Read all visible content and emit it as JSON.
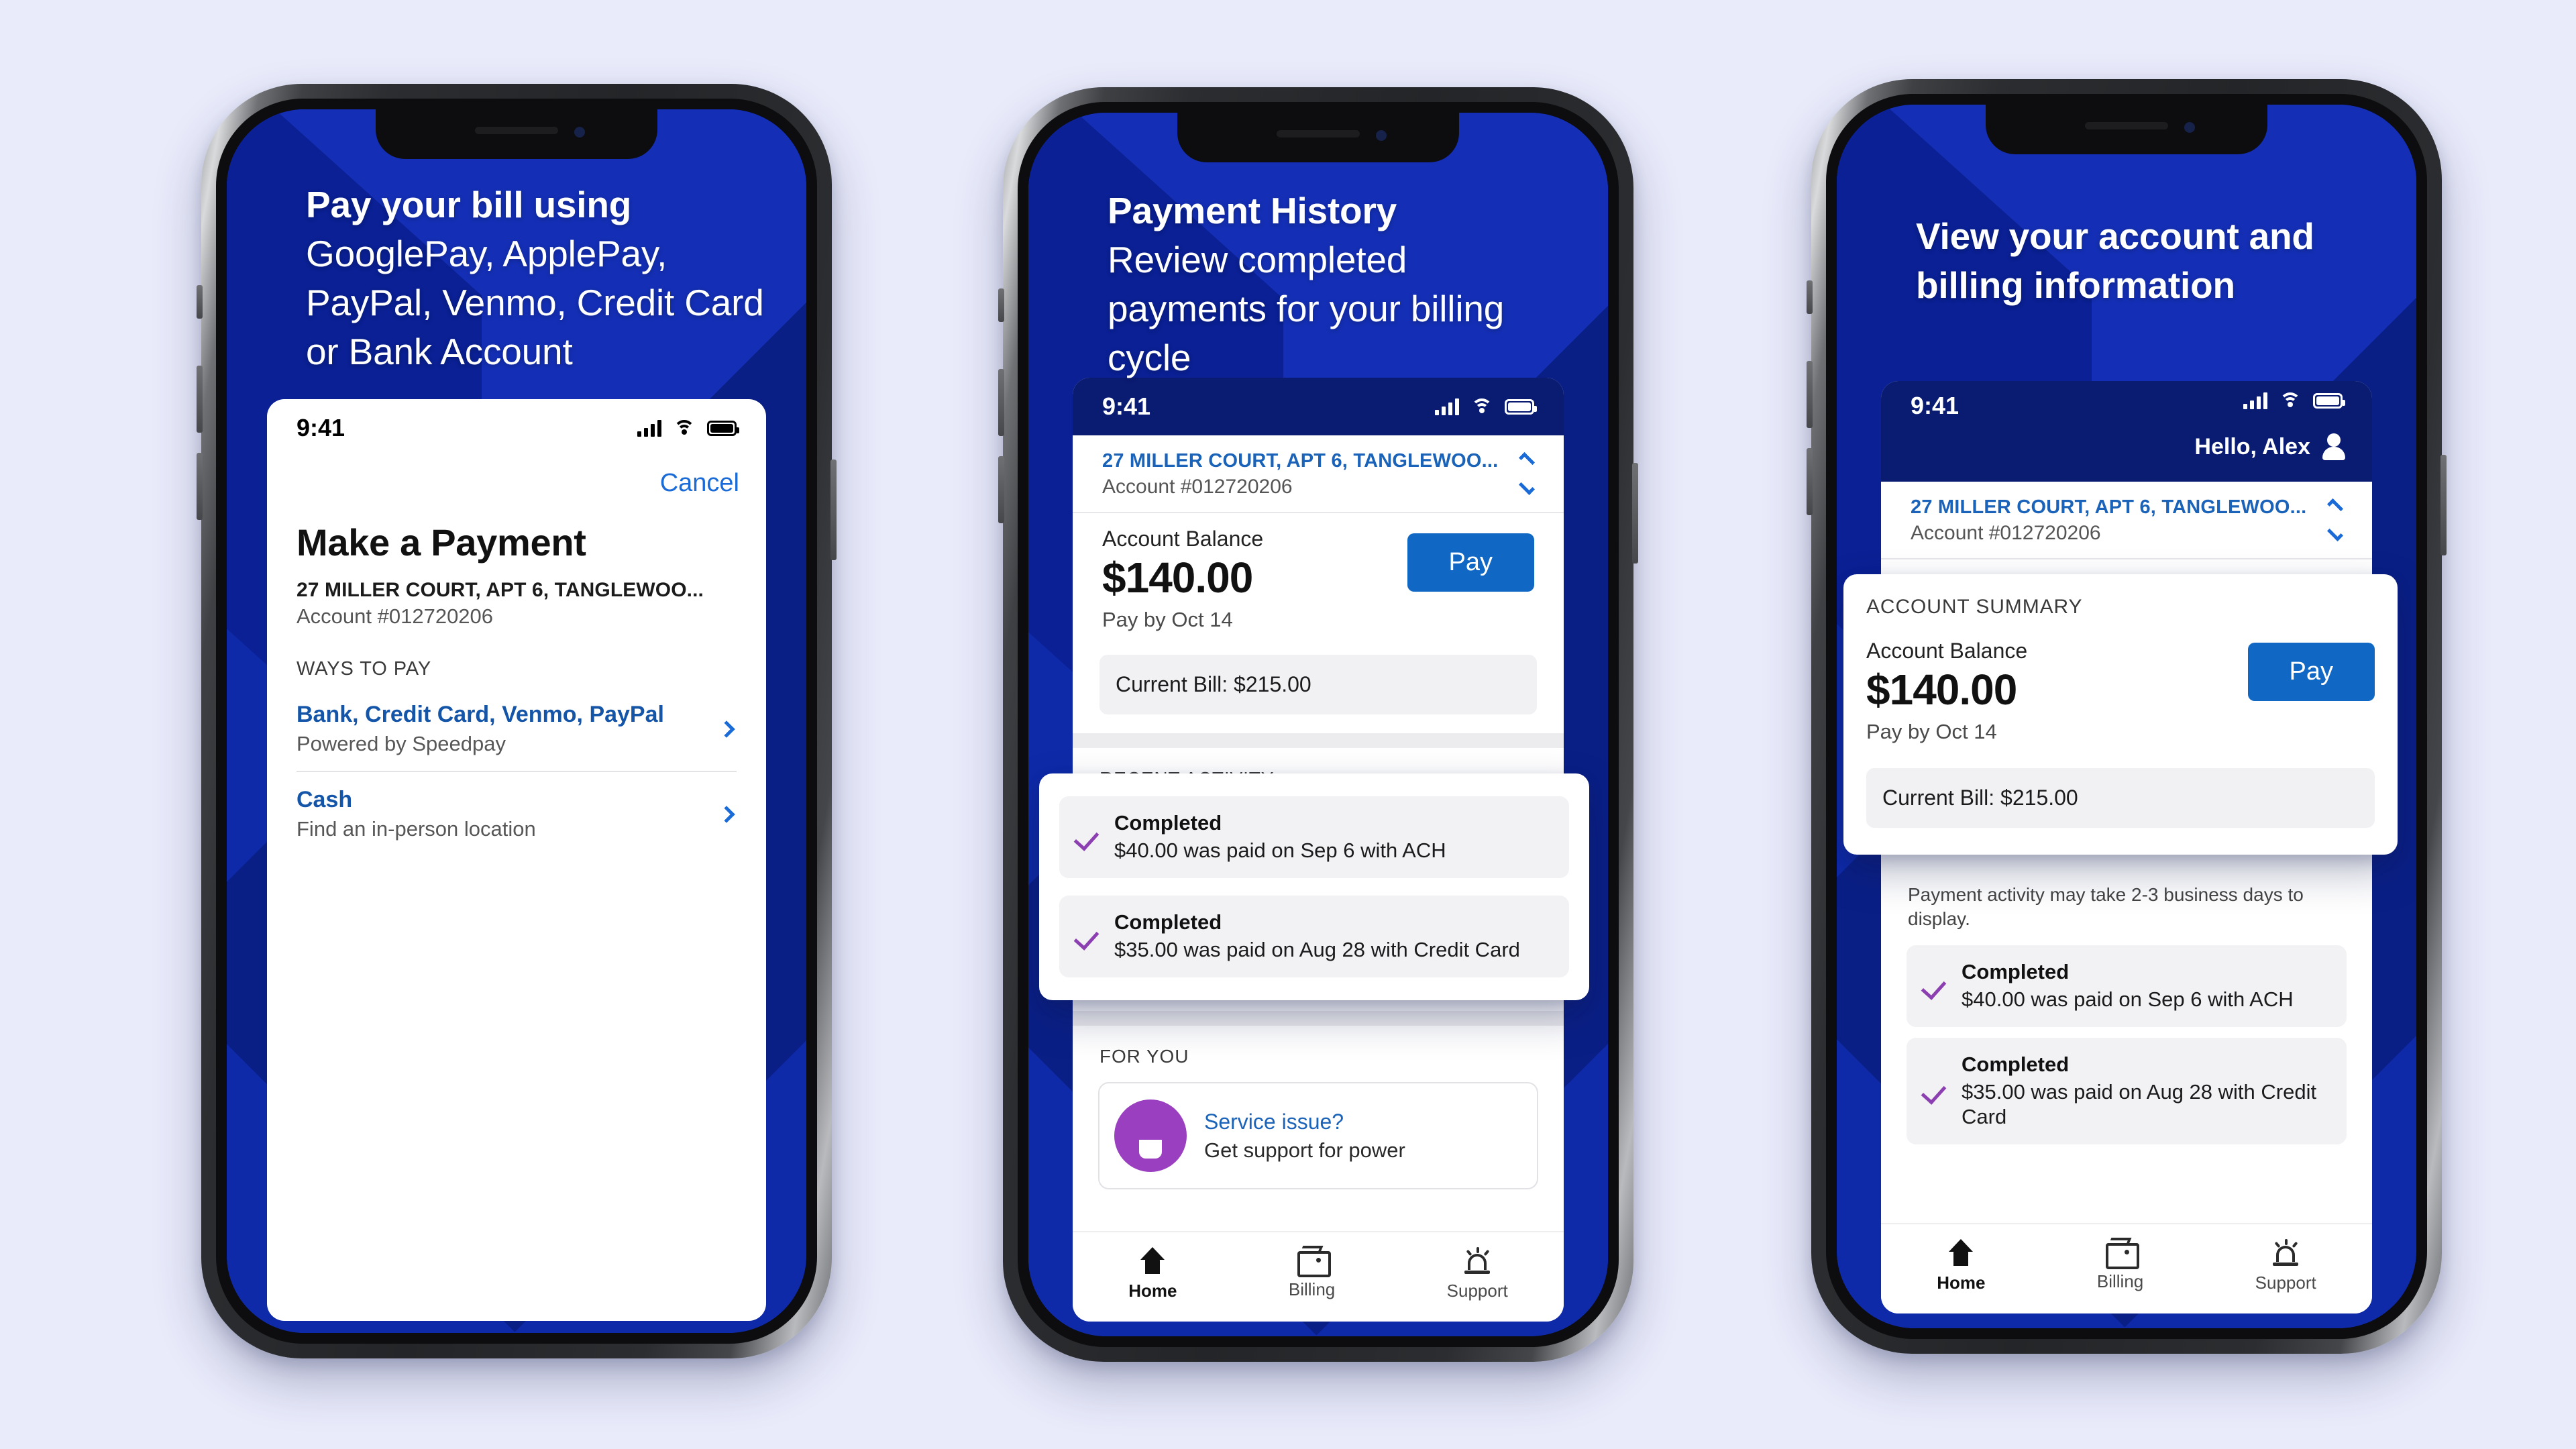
{
  "page": {
    "background_color": "#e9ebfb"
  },
  "common": {
    "status_time": "9:41",
    "address": "27 MILLER COURT, APT 6, TANGLEWOO...",
    "account_number": "Account #012720206",
    "account_balance_label": "Account Balance",
    "account_balance": "$140.00",
    "pay_by": "Pay by Oct 14",
    "pay_button": "Pay",
    "current_bill": "Current Bill: $215.00",
    "accent_blue": "#1167c4",
    "brand_navy": "#0e2aa8",
    "check_purple": "#8b3fb0",
    "tabs": [
      {
        "label": "Home",
        "icon": "home-icon",
        "active": true
      },
      {
        "label": "Billing",
        "icon": "wallet-icon",
        "active": false
      },
      {
        "label": "Support",
        "icon": "siren-icon",
        "active": false
      }
    ],
    "activity": [
      {
        "status": "Completed",
        "description": "$40.00 was paid on Sep 6 with ACH"
      },
      {
        "status": "Completed",
        "description": "$35.00 was paid on Aug 28 with Credit Card"
      }
    ]
  },
  "phone1": {
    "hero": {
      "bold": "Pay your bill using",
      "rest": " GooglePay, ApplePay, PayPal, Venmo, Credit Card or Bank Account"
    },
    "cancel_label": "Cancel",
    "screen_title": "Make a Payment",
    "ways_to_pay_label": "WAYS TO PAY",
    "methods": [
      {
        "title": "Bank, Credit Card, Venmo, PayPal",
        "subtitle": "Powered by Speedpay"
      },
      {
        "title": "Cash",
        "subtitle": "Find an in-person location"
      }
    ]
  },
  "phone2": {
    "hero": {
      "bold": "Payment History",
      "rest": "Review completed payments for your billing cycle"
    },
    "recent_activity_label": "RECENT ACTIVITY",
    "for_you_label": "FOR YOU",
    "for_you_card": {
      "title": "Service issue?",
      "subtitle": "Get support for power"
    }
  },
  "phone3": {
    "hero": {
      "bold": "View your account and billing information"
    },
    "greeting": "Hello, Alex",
    "account_summary_label": "ACCOUNT SUMMARY",
    "activity_note": "Payment activity may take 2-3 business days to display."
  }
}
